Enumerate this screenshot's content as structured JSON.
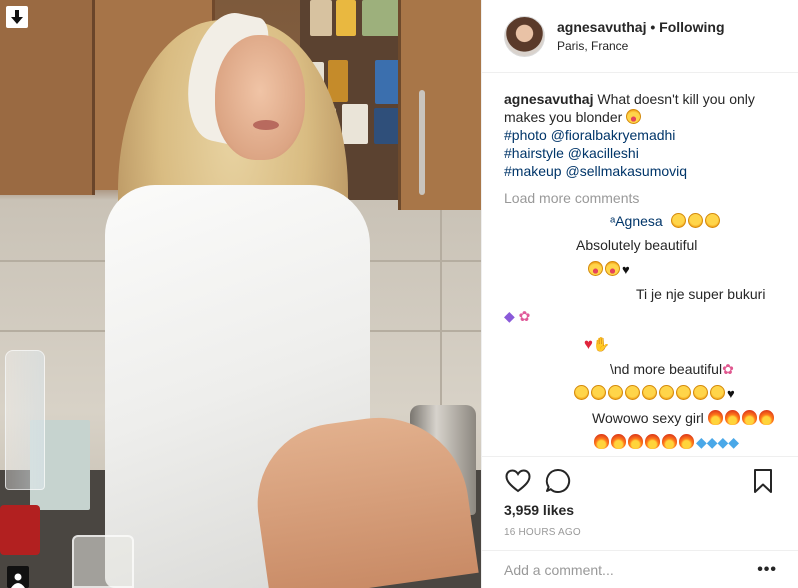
{
  "post": {
    "username": "agnesavuthaj",
    "separator": "•",
    "follow_status": "Following",
    "location": "Paris, France",
    "caption_text": "What doesn't kill you only makes you blonder",
    "tags": [
      "#photo @fioralbakryemadhi",
      "#hairstyle @kacilleshi",
      "#makeup @sellmakasumoviq"
    ],
    "load_more": "Load more comments",
    "comments": [
      {
        "text": "ᵃAgnesa"
      },
      {
        "text": "Absolutely beautiful"
      },
      {
        "text": "Ti je nje super bukuri"
      },
      {
        "text": "\\nd more beautiful"
      },
      {
        "text": "Wowowo sexy girl"
      }
    ],
    "likes": "3,959 likes",
    "time": "16 HOURS AGO",
    "comment_placeholder": "Add a comment...",
    "more_options": "•••"
  },
  "colors": {
    "link": "#003569",
    "muted": "#999999",
    "border": "#efefef",
    "text": "#262626"
  },
  "icons": {
    "top_left": "download-icon",
    "bottom_left": "user-tag-icon",
    "like": "heart-outline-icon",
    "comment": "comment-bubble-icon",
    "save": "bookmark-icon"
  }
}
